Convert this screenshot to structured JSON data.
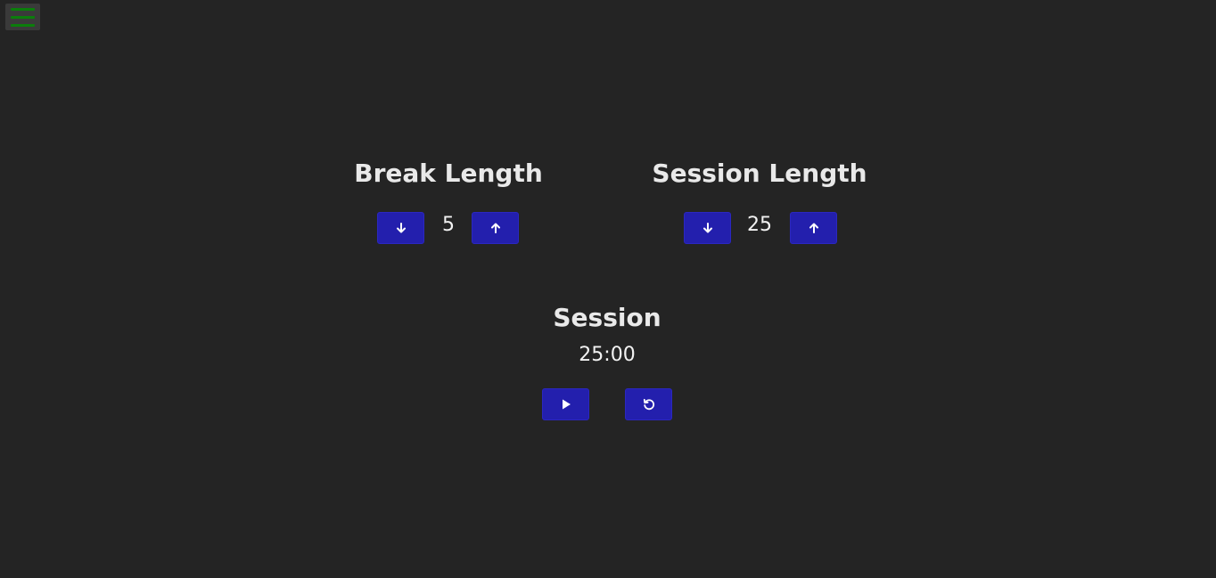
{
  "menu": {
    "icon": "hamburger-menu-icon",
    "color": "#0b7d0b"
  },
  "break": {
    "label": "Break Length",
    "value": "5",
    "decrement_icon": "arrow-down-icon",
    "increment_icon": "arrow-up-icon"
  },
  "session_length": {
    "label": "Session Length",
    "value": "25",
    "decrement_icon": "arrow-down-icon",
    "increment_icon": "arrow-up-icon"
  },
  "timer": {
    "label": "Session",
    "time": "25:00",
    "play_icon": "play-icon",
    "reset_icon": "reset-icon"
  },
  "colors": {
    "background": "#242424",
    "button": "#231fad",
    "text": "#f2f2f2"
  }
}
